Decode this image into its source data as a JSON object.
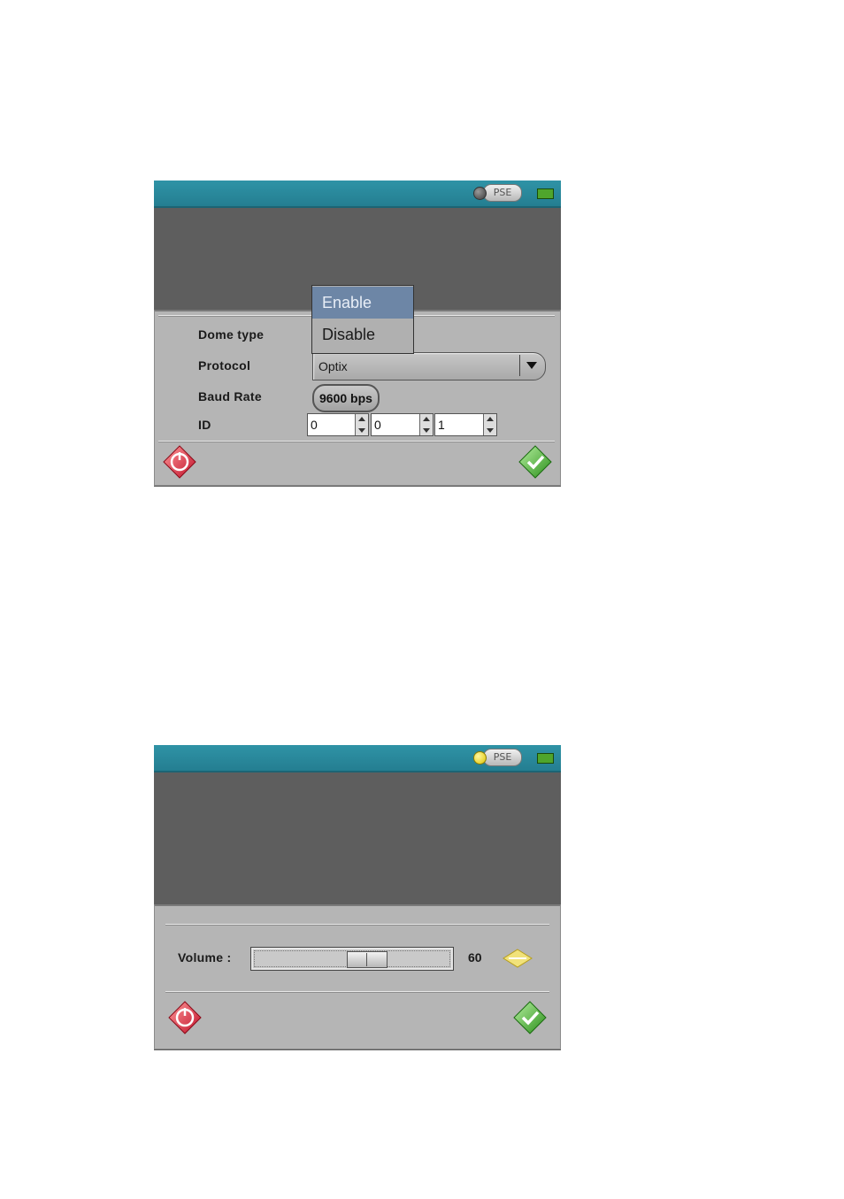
{
  "screen1": {
    "status": {
      "pse_label": "PSE",
      "led": "grey-icon",
      "battery": "battery-icon"
    },
    "fields": {
      "dome_type_label": "Dome type",
      "protocol_label": "Protocol",
      "protocol_value": "Optix",
      "baud_rate_label": "Baud Rate",
      "baud_rate_value": "9600 bps",
      "id_label": "ID",
      "id_values": [
        "0",
        "0",
        "1"
      ]
    },
    "dropdown": {
      "options": [
        "Enable",
        "Disable"
      ],
      "selected": "Enable"
    },
    "buttons": {
      "cancel_icon": "power-icon",
      "ok_icon": "check-icon"
    }
  },
  "screen2": {
    "status": {
      "pse_label": "PSE",
      "led": "yellow-icon",
      "battery": "battery-icon"
    },
    "volume": {
      "label": "Volume :",
      "value": "60",
      "level": 60
    },
    "buttons": {
      "cancel_icon": "power-icon",
      "ok_icon": "check-icon"
    }
  },
  "colors": {
    "topbar": "#2a8a9e",
    "screen_bg": "#5e5e5e",
    "panel_bg": "#b5b5b5",
    "highlight": "#6d86a6"
  }
}
